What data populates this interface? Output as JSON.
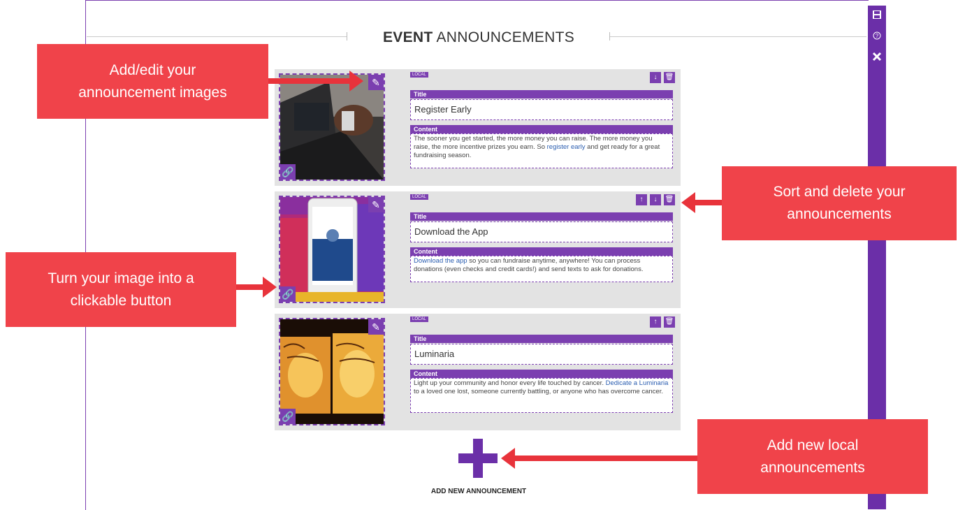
{
  "heading": {
    "bold": "EVENT",
    "rest": "ANNOUNCEMENTS"
  },
  "toolbar": {
    "save_icon": "save-icon",
    "help_icon": "help-icon",
    "close_icon": "close-icon"
  },
  "cards": [
    {
      "badge": "LOCAL",
      "title_label": "Title",
      "title_value": "Register Early",
      "content_label": "Content",
      "content_before": "The sooner you get started, the more money you can raise. The more money you raise, the more incentive prizes you earn. So ",
      "content_link": "register early",
      "content_after": " and get ready for a great fundraising season."
    },
    {
      "badge": "LOCAL",
      "title_label": "Title",
      "title_value": "Download the App",
      "content_label": "Content",
      "content_before": "",
      "content_link": "Download the app",
      "content_after": " so you can fundraise anytime, anywhere! You can process donations (even checks and credit cards!) and send texts to ask for donations."
    },
    {
      "badge": "LOCAL",
      "title_label": "Title",
      "title_value": "Luminaria",
      "content_label": "Content",
      "content_before": "Light up your community and honor every life touched by cancer. ",
      "content_link": "Dedicate a Luminaria",
      "content_after": " to a loved one lost, someone currently battling, or anyone who has overcome cancer."
    }
  ],
  "add_button_label": "ADD NEW ANNOUNCEMENT",
  "callouts": {
    "images": [
      "Add/edit your",
      "announcement images"
    ],
    "sort": [
      "Sort and delete your",
      "announcements"
    ],
    "link": [
      "Turn your image into a",
      "clickable button"
    ],
    "add": [
      "Add new local",
      "announcements"
    ]
  },
  "colors": {
    "accent": "#7b3fb0",
    "callout": "#f0434a",
    "card_bg": "#e3e3e3",
    "link": "#2a5db0"
  }
}
